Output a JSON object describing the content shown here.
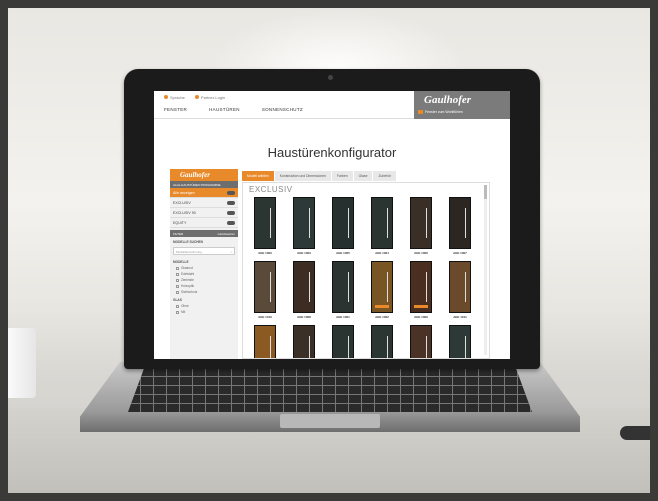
{
  "site": {
    "top_links": [
      "Sprache",
      "Partner-Login"
    ],
    "nav": [
      "FENSTER",
      "HAUSTÜREN",
      "SONNENSCHUTZ"
    ],
    "logo": "Gaulhofer",
    "logo_sub": "Fenster zum Wohlfühlen",
    "page_title": "Haustürenkonfigurator"
  },
  "sidebar": {
    "logo": "Gaulhofer",
    "head": "ALLE HAUSTÜREN PROGRAMME",
    "items": [
      {
        "label": "Alle anzeigen",
        "count": "",
        "active": true
      },
      {
        "label": "EXCLUSIV",
        "count": "",
        "active": false
      },
      {
        "label": "EXCLUSIV 90",
        "count": "",
        "active": false
      },
      {
        "label": "EQUITY",
        "count": "",
        "active": false
      }
    ],
    "filter_label": "FILTER",
    "filter_reset": "zurücksetzen",
    "modell_suchen": "MODELLE SUCHEN",
    "search_placeholder": "Modellbezeichnung",
    "group1": "MODELLE",
    "group1_options": [
      "Glasmot",
      "Edelstahl",
      "Zierleiste",
      "Holzoptik",
      "Sichtschutz"
    ],
    "group2": "GLAS",
    "group2_options": [
      "Ohne",
      "Mit"
    ]
  },
  "tabs": [
    "Modell wählen",
    "Konstruktion und Dimensionen",
    "Farben",
    "Glase",
    "Zubehör"
  ],
  "product_area": {
    "category": "EXCLUSIV",
    "doors": [
      {
        "code": "AEE 1000",
        "color": "#2b3633",
        "badge": false
      },
      {
        "code": "AEE 1003",
        "color": "#2d3936",
        "badge": false
      },
      {
        "code": "AEE 1005",
        "color": "#26302e",
        "badge": false
      },
      {
        "code": "AEE 1004",
        "color": "#2a3431",
        "badge": false
      },
      {
        "code": "AEE 1006",
        "color": "#3a2f26",
        "badge": false
      },
      {
        "code": "AEE 1007",
        "color": "#2b2622",
        "badge": false
      },
      {
        "code": "AEE 1010",
        "color": "#5a4a3a",
        "badge": false
      },
      {
        "code": "AEE 1008",
        "color": "#3d2c22",
        "badge": false
      },
      {
        "code": "AEE 1001",
        "color": "#2c3431",
        "badge": false
      },
      {
        "code": "AEE 1002",
        "color": "#7a5524",
        "badge": true
      },
      {
        "code": "AEE 1009",
        "color": "#4a2e1f",
        "badge": true
      },
      {
        "code": "AEE 1011",
        "color": "#6a4a2a",
        "badge": false
      },
      {
        "code": "",
        "color": "#8a5a22",
        "badge": false
      },
      {
        "code": "",
        "color": "#3a3028",
        "badge": false
      },
      {
        "code": "",
        "color": "#2a3431",
        "badge": false
      },
      {
        "code": "",
        "color": "#2b3633",
        "badge": false
      },
      {
        "code": "",
        "color": "#4a3326",
        "badge": false
      },
      {
        "code": "",
        "color": "#2d3936",
        "badge": false
      }
    ]
  }
}
